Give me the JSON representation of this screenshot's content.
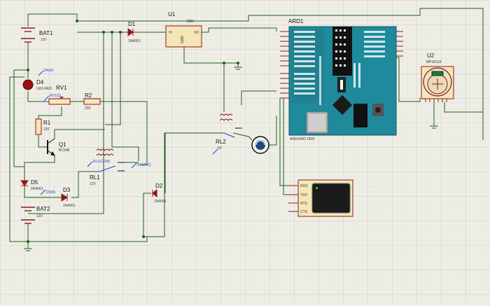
{
  "labels": {
    "bat1": "BAT1",
    "bat1_val": "12V",
    "bat2": "BAT2",
    "bat2_val": "12V",
    "u1": "U1",
    "u1_part": "7805",
    "u1_vi": "VI",
    "u1_vo": "VO",
    "u1_gnd": "GND",
    "d1": "D1",
    "d1_part": "1N4001",
    "d2": "D2",
    "d2_part": "1N4001",
    "d3": "D3",
    "d3_part": "1N4001",
    "d4": "D4",
    "d4_part": "LED-RED",
    "d5": "D5",
    "d5_part": "1N4001",
    "rv1": "RV1",
    "r1": "R1",
    "r1_val": "220",
    "r2": "R2",
    "r2_val": "220",
    "q1": "Q1",
    "q1_part": "BC548",
    "rl1": "RL1",
    "rl1_val": "12V",
    "rl2": "RL2",
    "rl2_val": "5V",
    "ard": "ARD1",
    "ard_sub": "ARDUINO UNO",
    "u2": "U2",
    "u2_part": "MPS4115",
    "term": [
      "RXD",
      "TXD",
      "RTS",
      "CTS"
    ]
  },
  "probes": {
    "d4": "D4(A)",
    "rv1": "RV1(3)",
    "rl1_com": "RL1(COM)",
    "rl1_nc": "RL1(NC)",
    "d3": "D3(A)"
  },
  "colors": {
    "wire": "#1f5e1a",
    "component": "#8b1a1a",
    "arduino": "#1e8a9c",
    "grid_major": "#c4c3b7",
    "grid_minor": "#dddcd2"
  }
}
